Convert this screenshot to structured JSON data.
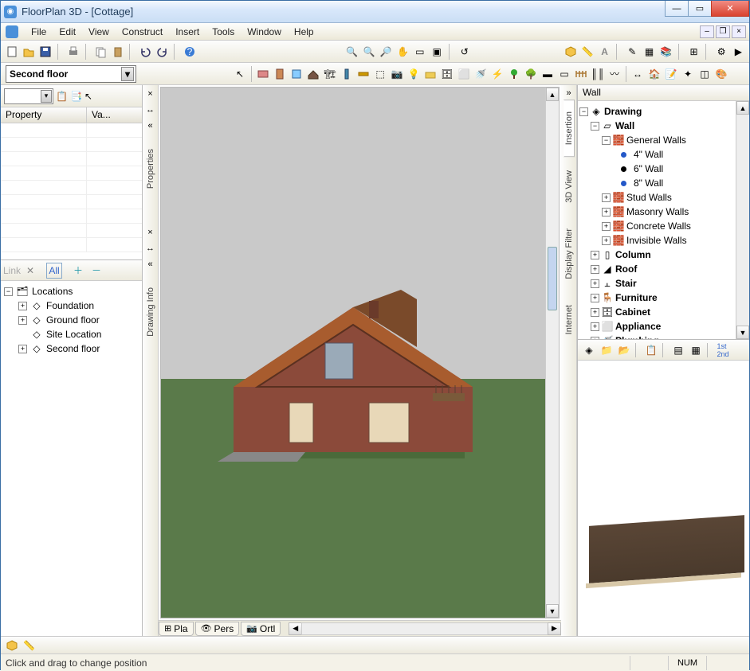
{
  "window": {
    "title": "FloorPlan 3D - [Cottage]"
  },
  "menu": {
    "file": "File",
    "edit": "Edit",
    "view": "View",
    "construct": "Construct",
    "insert": "Insert",
    "tools": "Tools",
    "window": "Window",
    "help": "Help"
  },
  "floor_selector": {
    "value": "Second floor"
  },
  "properties": {
    "header_property": "Property",
    "header_value": "Va..."
  },
  "locations_bar": {
    "all_label": "All"
  },
  "locations": {
    "root": "Locations",
    "items": [
      "Foundation",
      "Ground floor",
      "Site Location",
      "Second floor"
    ]
  },
  "left_vtabs": {
    "properties": "Properties",
    "drawing_info": "Drawing Info"
  },
  "view_tabs": {
    "plan": "Pla",
    "perspective": "Pers",
    "ortho": "Ortl"
  },
  "right_vtabs": {
    "insertion": "Insertion",
    "view3d": "3D View",
    "display_filter": "Display Filter",
    "internet": "Internet"
  },
  "right_panel": {
    "title": "Wall",
    "tree": {
      "drawing": "Drawing",
      "wall": "Wall",
      "general_walls": "General Walls",
      "w4": "4\" Wall",
      "w6": "6\" Wall",
      "w8": "8\" Wall",
      "stud": "Stud Walls",
      "masonry": "Masonry Walls",
      "concrete": "Concrete Walls",
      "invisible": "Invisible Walls",
      "column": "Column",
      "roof": "Roof",
      "stair": "Stair",
      "furniture": "Furniture",
      "cabinet": "Cabinet",
      "appliance": "Appliance",
      "plumbing": "Plumbing"
    }
  },
  "status": {
    "message": "Click and drag to change position",
    "num": "NUM"
  }
}
